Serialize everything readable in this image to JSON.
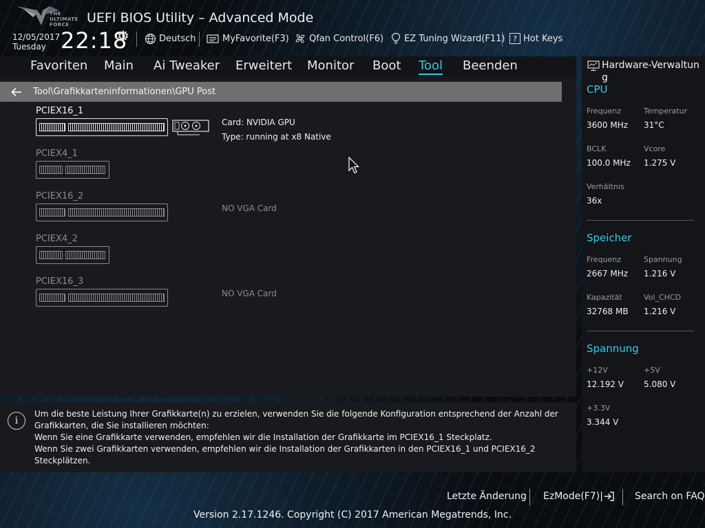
{
  "header": {
    "logo_text": [
      "THE",
      "ULTIMATE",
      "FORCE"
    ],
    "title": "UEFI BIOS Utility – Advanced Mode",
    "date": "12/05/2017",
    "day": "Tuesday",
    "time": "22:18",
    "buttons": {
      "language": "Deutsch",
      "myfavorite": "MyFavorite(F3)",
      "qfan": "Qfan Control(F6)",
      "ez_tuning": "EZ Tuning Wizard(F11)",
      "hotkeys": "Hot Keys"
    },
    "hotkeys_glyph": "?"
  },
  "nav": {
    "items": [
      "Favoriten",
      "Main",
      "Ai Tweaker",
      "Erweitert",
      "Monitor",
      "Boot",
      "Tool",
      "Beenden"
    ],
    "active": "Tool"
  },
  "breadcrumb": "Tool\\Grafikkarteninformationen\\GPU Post",
  "slots": [
    {
      "name": "PCIEX16_1",
      "card": "Card: NVIDIA GPU",
      "type": "Type: running at x8 Native"
    },
    {
      "name": "PCIEX4_1"
    },
    {
      "name": "PCIEX16_2",
      "status": "NO VGA Card"
    },
    {
      "name": "PCIEX4_2"
    },
    {
      "name": "PCIEX16_3",
      "status": "NO VGA Card"
    }
  ],
  "info": {
    "icon_glyph": "i",
    "lines": [
      "Um die beste Leistung Ihrer Grafikkarte(n) zu erzielen, verwenden Sie die folgende Konfiguration entsprechend der Anzahl der Grafikkarten, die Sie installieren möchten:",
      "Wenn Sie eine Grafikkarte verwenden, empfehlen wir die Installation der Grafikkarte im PCIEX16_1 Steckplatz.",
      "Wenn Sie zwei Grafikkarten verwenden, empfehlen wir die Installation der Grafikkarten in den PCIEX16_1 und PCIEX16_2 Steckplätzen."
    ]
  },
  "hardware": {
    "title": "Hardware-Verwaltung",
    "cpu": {
      "heading": "CPU",
      "frequenz_label": "Frequenz",
      "frequenz": "3600 MHz",
      "temperatur_label": "Temperatur",
      "temperatur": "31°C",
      "bclk_label": "BCLK",
      "bclk": "100.0 MHz",
      "vcore_label": "Vcore",
      "vcore": "1.275 V",
      "verhaeltnis_label": "Verhältnis",
      "verhaeltnis": "36x"
    },
    "speicher": {
      "heading": "Speicher",
      "frequenz_label": "Frequenz",
      "frequenz": "2667 MHz",
      "spannung_label": "Spannung",
      "spannung": "1.216 V",
      "kapazitaet_label": "Kapazität",
      "kapazitaet": "32768 MB",
      "vol_chcd_label": "Vol_CHCD",
      "vol_chcd": "1.216 V"
    },
    "spannung": {
      "heading": "Spannung",
      "v12_label": "+12V",
      "v12": "12.192 V",
      "v5_label": "+5V",
      "v5": "5.080 V",
      "v33_label": "+3.3V",
      "v33": "3.344 V"
    }
  },
  "footer": {
    "last_change": "Letzte Änderung",
    "ezmode": "EzMode(F7)|",
    "faq": "Search on FAQ",
    "version": "Version 2.17.1246. Copyright (C) 2017 American Megatrends, Inc."
  },
  "colors": {
    "accent": "#3cc8e8",
    "panel": "#181a1d",
    "breadcrumb": "#6e6f71"
  }
}
